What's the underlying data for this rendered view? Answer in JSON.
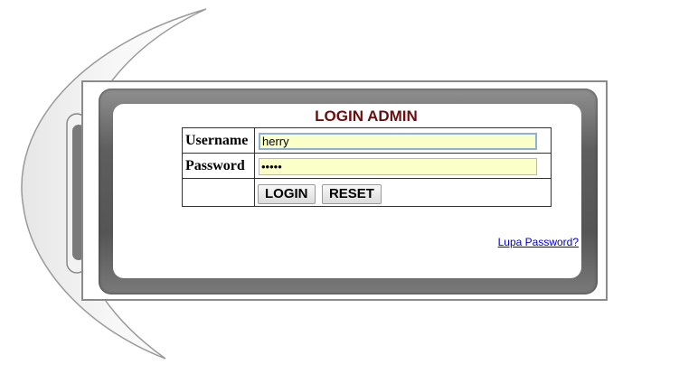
{
  "login": {
    "title": "LOGIN ADMIN",
    "username_label": "Username",
    "username_value": "herry",
    "password_label": "Password",
    "password_value": "•••••",
    "login_button": "LOGIN",
    "reset_button": "RESET",
    "forgot_link": "Lupa Password?"
  },
  "colors": {
    "title": "#6b0e0e",
    "input_background": "#fbffc8",
    "link": "#0000cc"
  }
}
